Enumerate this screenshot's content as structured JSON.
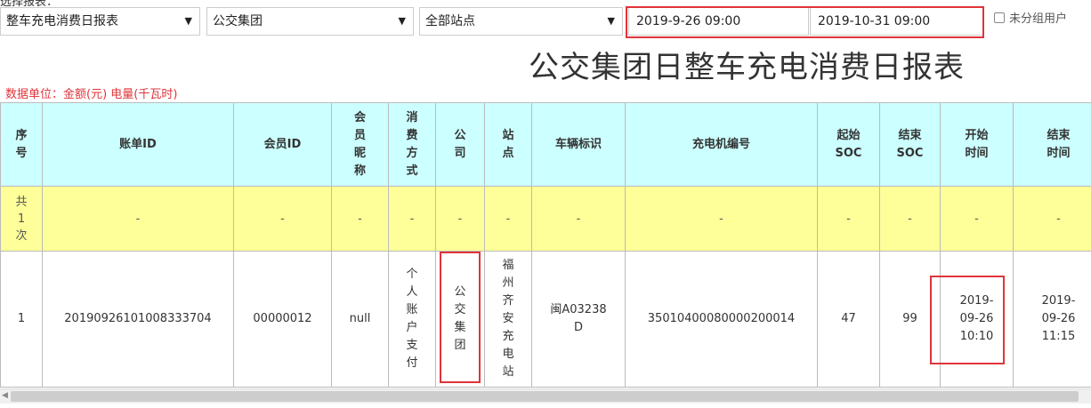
{
  "top_label": "选择报表：",
  "filters": {
    "report_type": "整车充电消费日报表",
    "company": "公交集团",
    "station": "全部站点",
    "start_time": "2019-9-26 09:00",
    "end_time": "2019-10-31 09:00",
    "ungrouped_users_label": "未分组用户"
  },
  "report_title": "公交集团日整车充电消费日报表",
  "unit_note": "数据单位：金额(元)    电量(千瓦时)",
  "columns": [
    "序号",
    "账单ID",
    "会员ID",
    "会员昵称",
    "消费方式",
    "公司",
    "站点",
    "车辆标识",
    "充电机编号",
    "起始SOC",
    "结束SOC",
    "开始时间",
    "结束时间"
  ],
  "total_row": {
    "label": "共1次",
    "cells": [
      "-",
      "-",
      "-",
      "-",
      "-",
      "-",
      "-",
      "-",
      "-",
      "-",
      "-",
      "-"
    ]
  },
  "rows": [
    {
      "index": "1",
      "bill_id": "20190926101008333704",
      "member_id": "00000012",
      "nickname": "null",
      "payment": "个人账户支付",
      "company": "公交集团",
      "station": "福州齐安充电站",
      "vehicle": "闽A03238D",
      "charger_no": "35010400080000200014",
      "start_soc": "47",
      "end_soc": "99",
      "start_time": "2019-09-26 10:10",
      "end_time": "2019-09-26 11:15"
    }
  ],
  "colors": {
    "header_bg": "#ccffff",
    "total_bg": "#ffff99",
    "highlight": "#e0343a"
  }
}
